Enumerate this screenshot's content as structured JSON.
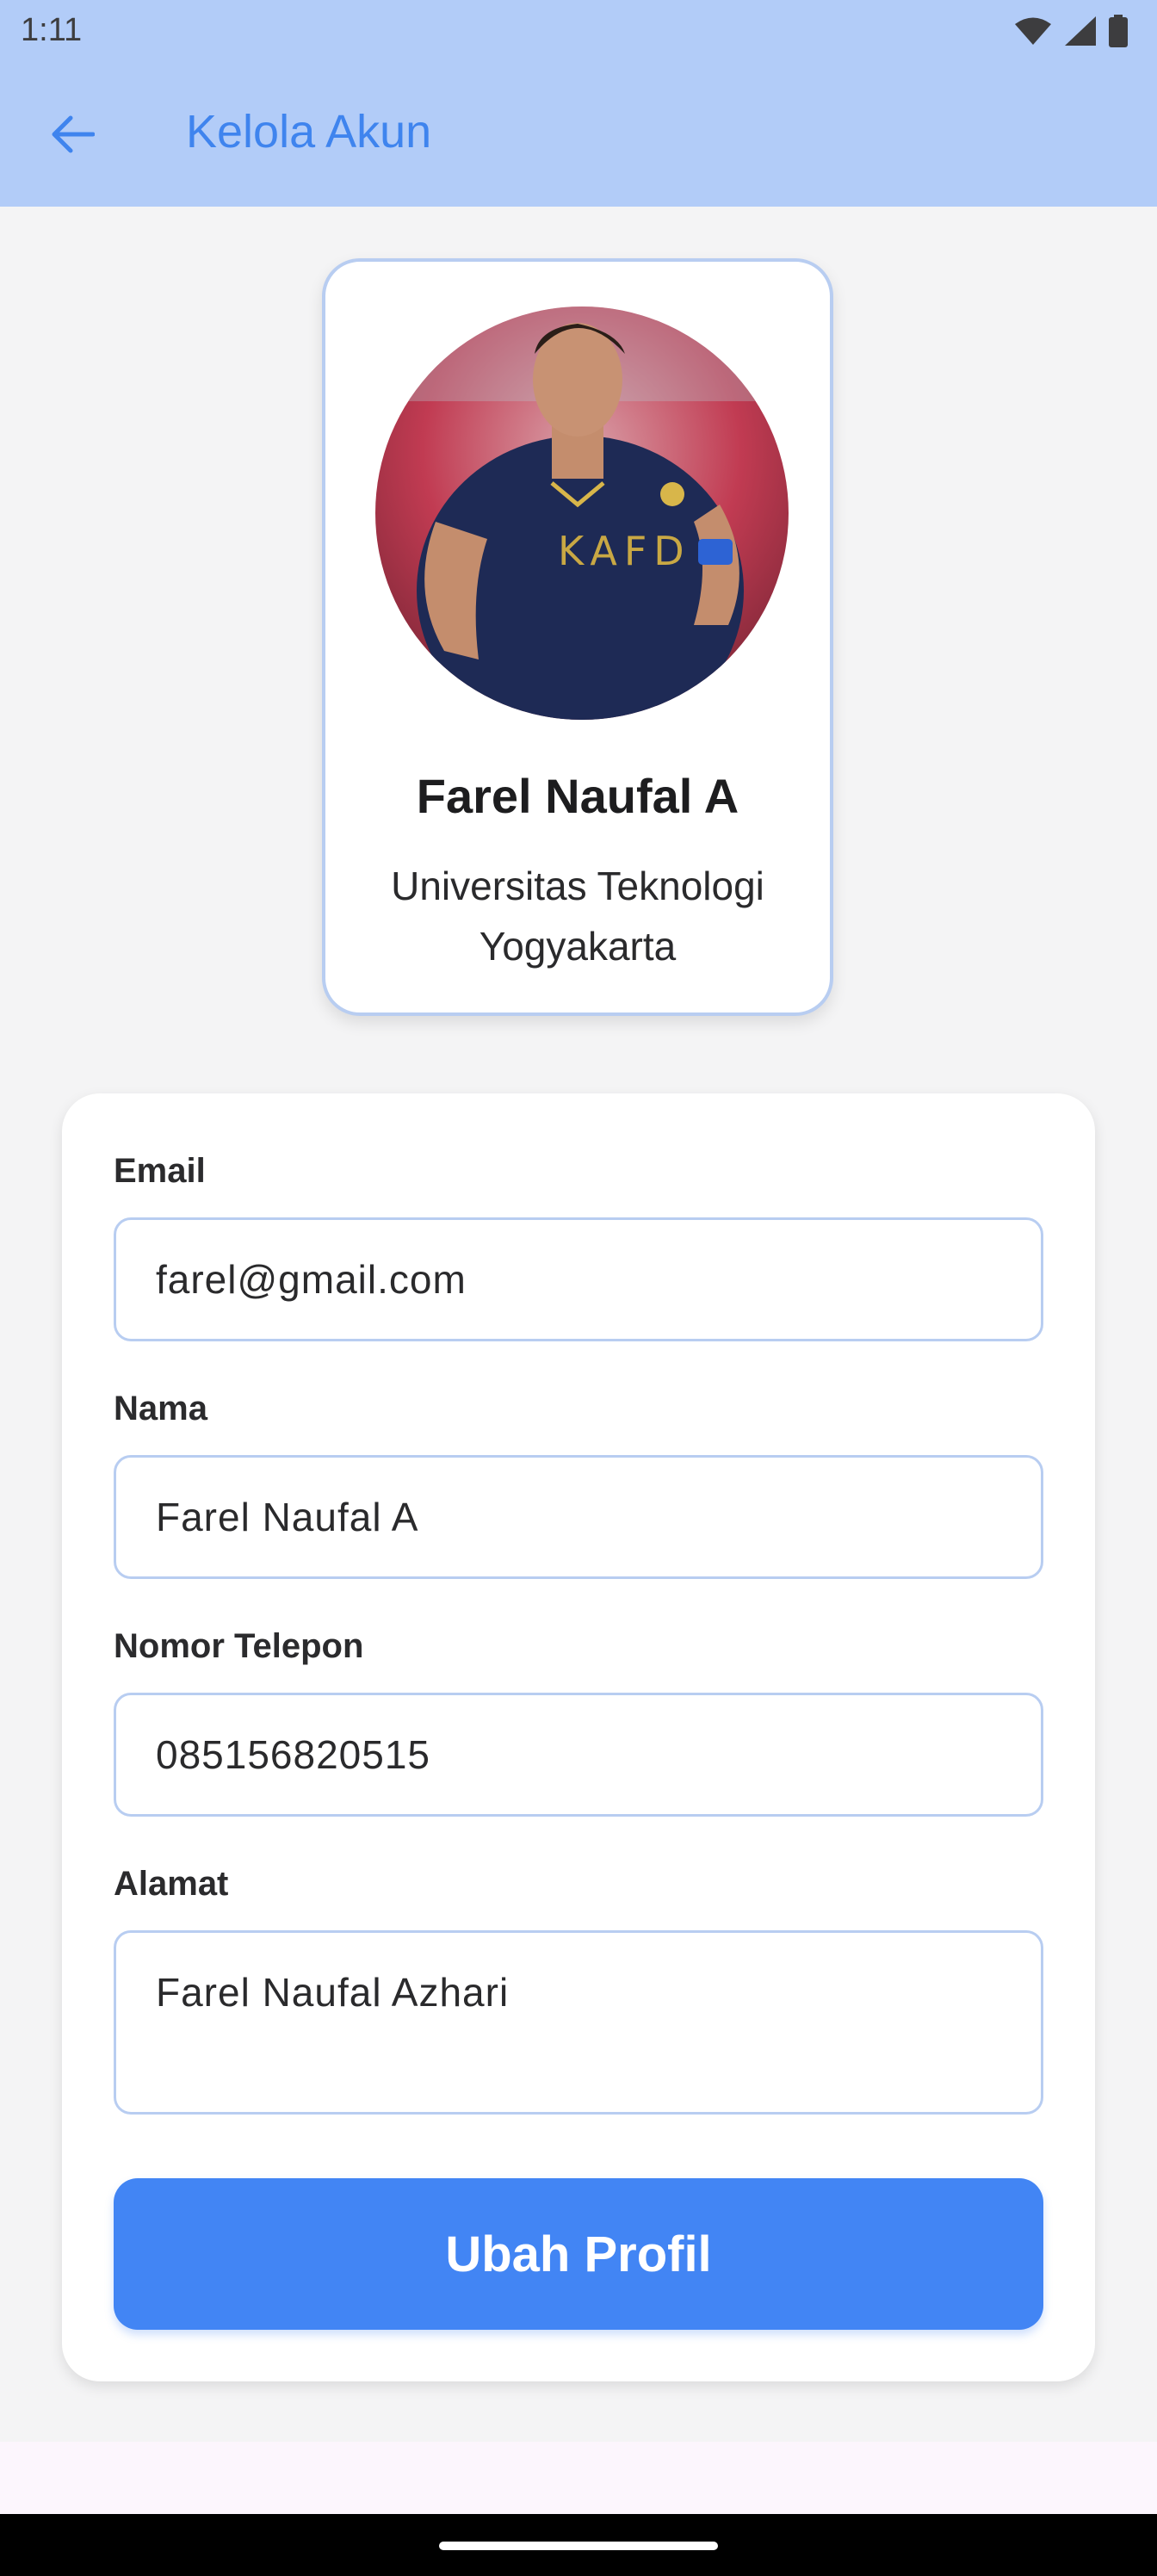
{
  "status_bar": {
    "time": "1:11"
  },
  "app_bar": {
    "title": "Kelola Akun"
  },
  "profile": {
    "name": "Farel Naufal A",
    "university": "Universitas Teknologi Yogyakarta"
  },
  "form": {
    "email": {
      "label": "Email",
      "value": "farel@gmail.com"
    },
    "name": {
      "label": "Nama",
      "value": "Farel Naufal A"
    },
    "phone": {
      "label": "Nomor Telepon",
      "value": "085156820515"
    },
    "address": {
      "label": "Alamat",
      "value": "Farel Naufal Azhari"
    },
    "submit_label": "Ubah Profil"
  },
  "colors": {
    "app_bar_bg": "#b2ccf8",
    "accent": "#4285f4",
    "title": "#3f84ee",
    "field_border": "#b8cdf1"
  },
  "icons": {
    "back": "arrow-left-icon",
    "wifi": "wifi-icon",
    "signal": "cell-signal-icon",
    "battery": "battery-icon"
  }
}
